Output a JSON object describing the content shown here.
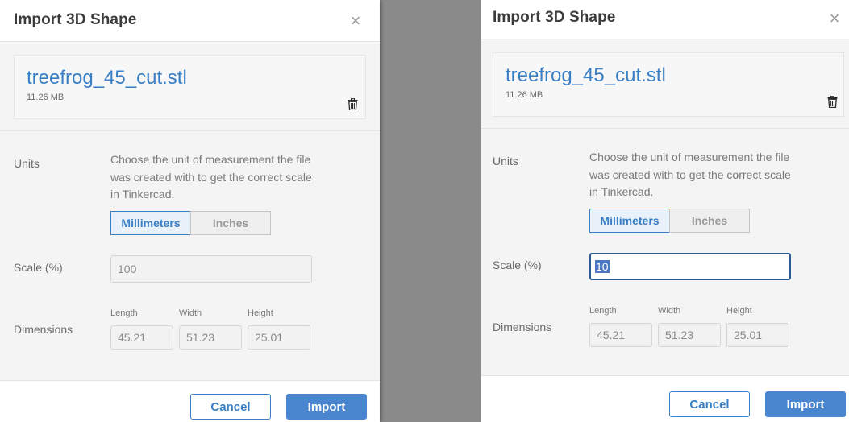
{
  "left": {
    "title": "Import 3D Shape",
    "close_glyph": "×",
    "file": {
      "name": "treefrog_45_cut.stl",
      "size": "11.26 MB"
    },
    "units": {
      "label": "Units",
      "description": "Choose the unit of measurement the file was created with to get the correct scale in Tinkercad.",
      "options": [
        "Millimeters",
        "Inches"
      ],
      "selected": "Millimeters"
    },
    "scale": {
      "label": "Scale (%)",
      "value": "100"
    },
    "dimensions": {
      "label": "Dimensions",
      "length_label": "Length",
      "length": "45.21",
      "width_label": "Width",
      "width": "51.23",
      "height_label": "Height",
      "height": "25.01"
    },
    "buttons": {
      "cancel": "Cancel",
      "import": "Import"
    }
  },
  "right": {
    "title": "Import 3D Shape",
    "close_glyph": "×",
    "file": {
      "name": "treefrog_45_cut.stl",
      "size": "11.26 MB"
    },
    "units": {
      "label": "Units",
      "description": "Choose the unit of measurement the file was created with to get the correct scale in Tinkercad.",
      "options": [
        "Millimeters",
        "Inches"
      ],
      "selected": "Millimeters"
    },
    "scale": {
      "label": "Scale (%)",
      "value": "10"
    },
    "dimensions": {
      "label": "Dimensions",
      "length_label": "Length",
      "length": "45.21",
      "width_label": "Width",
      "width": "51.23",
      "height_label": "Height",
      "height": "25.01"
    },
    "buttons": {
      "cancel": "Cancel",
      "import": "Import"
    }
  },
  "icons": {
    "close": "close-icon",
    "delete": "trash-icon"
  },
  "colors": {
    "accent": "#3a7fc4",
    "import_button": "#4a86cf",
    "backdrop": "#8a8a8a",
    "focus_border": "#2b5b93"
  }
}
